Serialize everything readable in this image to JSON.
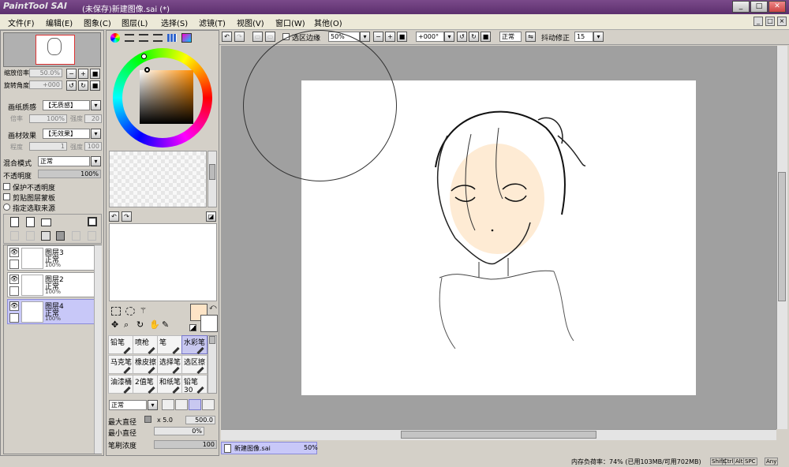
{
  "window": {
    "logo": "PaintTool SAI",
    "title": "(未保存)新建图像.sai (*)",
    "controls": [
      "_",
      "□",
      "✕"
    ]
  },
  "menu": [
    "文件(F)",
    "编辑(E)",
    "图象(C)",
    "图层(L)",
    "选择(S)",
    "滤镜(T)",
    "视图(V)",
    "窗口(W)",
    "其他(O)"
  ],
  "navigator": {
    "zoom_label": "缩放倍率",
    "zoom_value": "50.0%",
    "rotate_label": "旋转角度",
    "rotate_value": "+000"
  },
  "paper_texture": {
    "label": "画纸质感",
    "value": "【无质感】",
    "s1_label": "倍率",
    "s1_value": "100%",
    "s2_label": "强度",
    "s2_value": "20"
  },
  "paper_effect": {
    "label": "画材效果",
    "value": "【无效果】",
    "s1_label": "程度",
    "s1_value": "1",
    "s2_label": "强度",
    "s2_value": "100"
  },
  "blend": {
    "label": "混合模式",
    "value": "正常",
    "opacity_label": "不透明度",
    "opacity_value": "100%"
  },
  "options": {
    "preserve_opacity": "保护不透明度",
    "clipping": "剪贴图层蒙板",
    "selection_source": "指定选取来源"
  },
  "layers": [
    {
      "name": "图层3",
      "mode": "正常",
      "opacity": "100%",
      "selected": false
    },
    {
      "name": "图层2",
      "mode": "正常",
      "opacity": "100%",
      "selected": false
    },
    {
      "name": "图层4",
      "mode": "正常",
      "opacity": "100%",
      "selected": true
    }
  ],
  "colors": {
    "primary": "#fde4c6",
    "secondary": "#ffffff",
    "picker_hue": "#ff8c00"
  },
  "tools": [
    {
      "label": "铅笔",
      "selected": false
    },
    {
      "label": "喷枪",
      "selected": false
    },
    {
      "label": "笔",
      "selected": false
    },
    {
      "label": "水彩笔",
      "selected": true
    },
    {
      "label": "马克笔",
      "selected": false
    },
    {
      "label": "橡皮擦",
      "selected": false
    },
    {
      "label": "选择笔",
      "selected": false
    },
    {
      "label": "选区擦",
      "selected": false
    },
    {
      "label": "油漆桶",
      "selected": false
    },
    {
      "label": "2值笔",
      "selected": false
    },
    {
      "label": "和纸笔",
      "selected": false
    },
    {
      "label": "铅笔30",
      "selected": false
    }
  ],
  "brush": {
    "mode": "正常",
    "max_size_label": "最大直径",
    "max_size_mult": "x 5.0",
    "max_size_value": "500.0",
    "min_size_label": "最小直径",
    "min_size_value": "0%",
    "density_label": "笔刷浓度",
    "density_value": "100"
  },
  "canvas_toolbar": {
    "selection_edge": "选区边缘",
    "zoom": "50%",
    "angle": "+000°",
    "blend": "正常",
    "stabilizer_label": "抖动修正",
    "stabilizer_value": "15"
  },
  "tab": {
    "name": "新建图像.sai",
    "zoom": "50%"
  },
  "status": {
    "memory": "内存负荷率：74%  (已用103MB/可用702MB)",
    "keys": [
      "Shift",
      "Ctrl",
      "Alt",
      "SPC",
      "Any"
    ]
  }
}
